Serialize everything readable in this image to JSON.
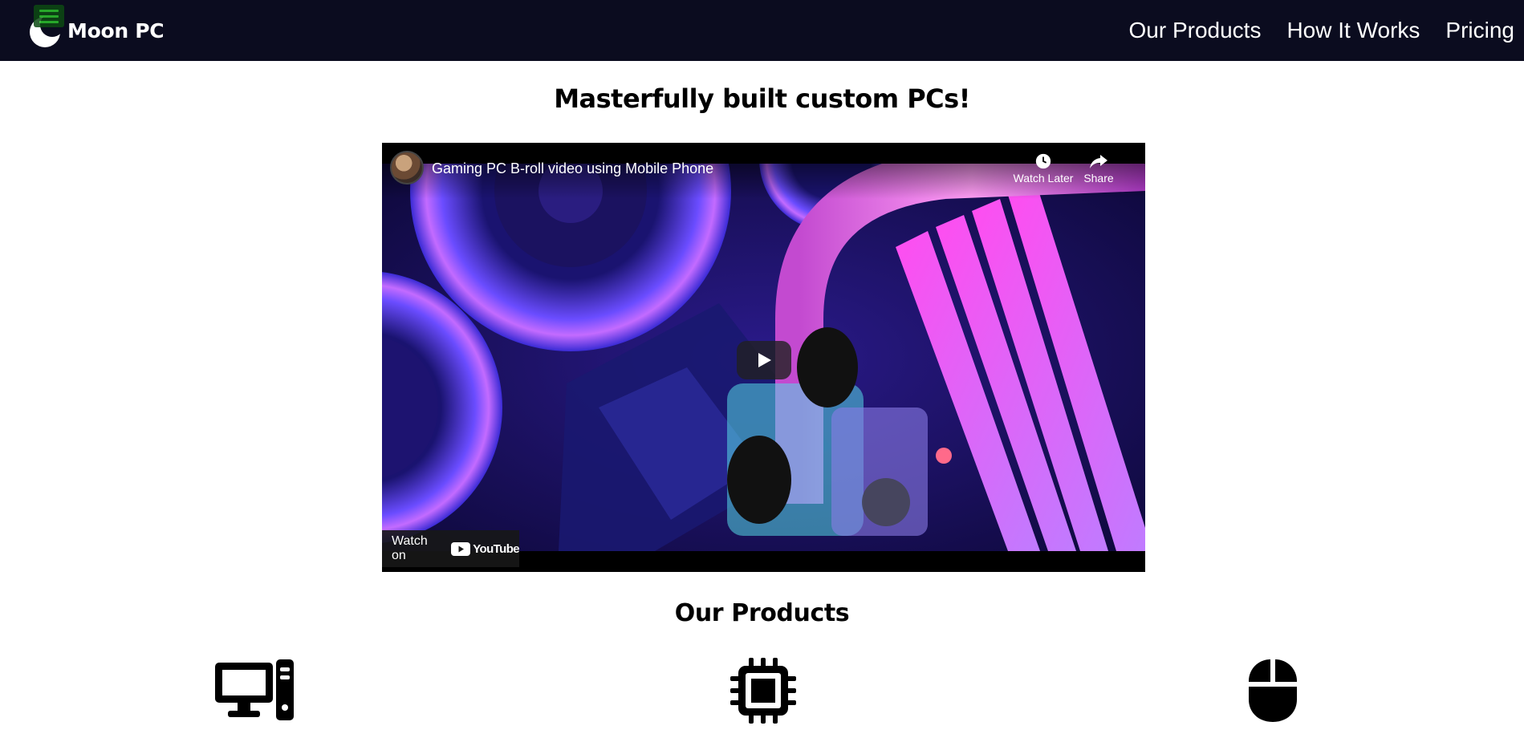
{
  "header": {
    "brand_name": "Moon PC",
    "logo_icon": "moon-icon",
    "menu_icon": "hamburger-menu-icon",
    "nav": [
      {
        "label": "Our Products"
      },
      {
        "label": "How It Works"
      },
      {
        "label": "Pricing"
      }
    ],
    "colors": {
      "background": "#0b0c1f",
      "text": "#ffffff"
    }
  },
  "hero": {
    "title": "Masterfully built custom PCs!"
  },
  "video": {
    "title": "Gaming PC B-roll video using Mobile Phone",
    "watch_later_label": "Watch Later",
    "share_label": "Share",
    "watch_on_label": "Watch on",
    "youtube_label": "YouTube",
    "play_icon": "play-icon",
    "watch_later_icon": "clock-icon",
    "share_icon": "share-arrow-icon"
  },
  "products": {
    "title": "Our Products",
    "items": [
      {
        "icon": "desktop-computer-icon"
      },
      {
        "icon": "cpu-chip-icon"
      },
      {
        "icon": "computer-mouse-icon"
      }
    ]
  }
}
